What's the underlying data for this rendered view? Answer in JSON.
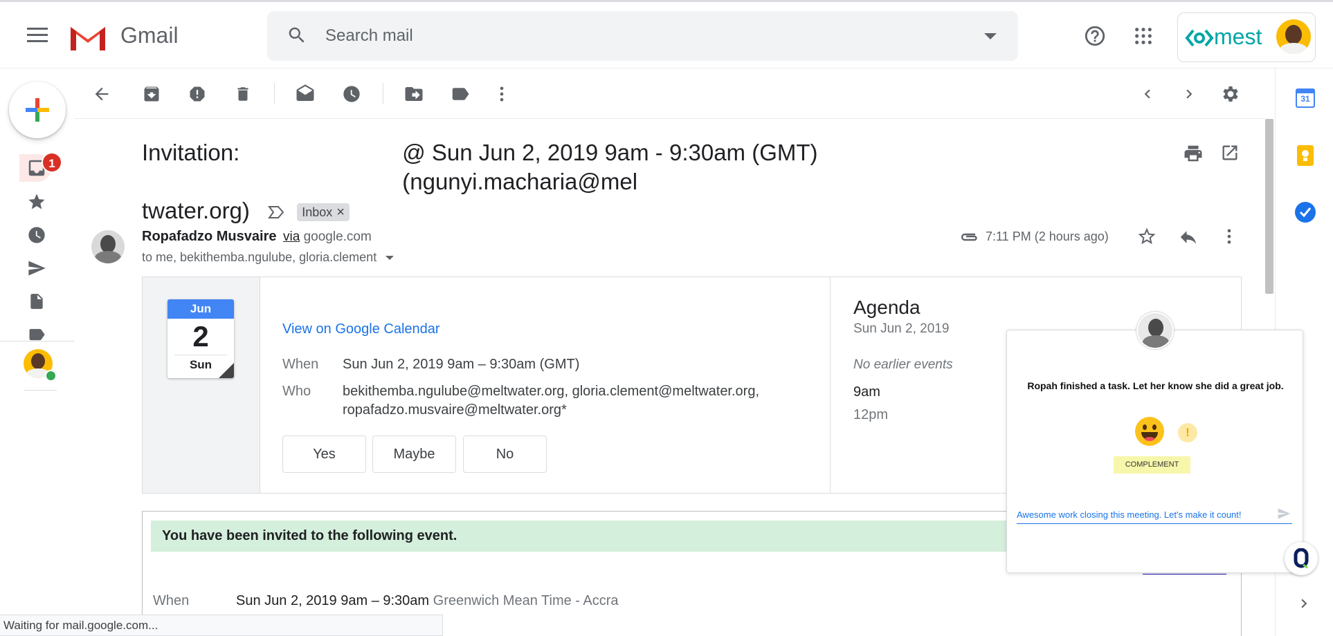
{
  "app": {
    "name": "Gmail"
  },
  "search": {
    "placeholder": "Search mail"
  },
  "account": {
    "org_logo_text": "mest"
  },
  "nav": {
    "inbox_badge": "1"
  },
  "email": {
    "subject_line1_left": "Invitation:",
    "subject_line1_right": "@ Sun Jun 2, 2019 9am - 9:30am (GMT) (ngunyi.macharia@mel",
    "subject_line2": "twater.org)",
    "label": "Inbox",
    "label_remove": "×",
    "sender_name": "Ropafadzo Musvaire",
    "via": "via",
    "via_domain": "google.com",
    "recipients": "to me, bekithemba.ngulube, gloria.clement",
    "time": "7:11 PM (2 hours ago)"
  },
  "invite": {
    "month": "Jun",
    "day": "2",
    "weekday": "Sun",
    "view_link": "View on Google Calendar",
    "when_label": "When",
    "when_value": "Sun Jun 2, 2019 9am – 9:30am (GMT)",
    "who_label": "Who",
    "who_line1": "bekithemba.ngulube@meltwater.org, gloria.clement@meltwater.org,",
    "who_line2": "ropafadzo.musvaire@meltwater.org*",
    "yes": "Yes",
    "maybe": "Maybe",
    "no": "No"
  },
  "agenda": {
    "title": "Agenda",
    "date": "Sun Jun 2, 2019",
    "no_earlier": "No earlier events",
    "slot_1": "9am",
    "slot_2": "12pm"
  },
  "body": {
    "banner": "You have been invited to the following event.",
    "more_details": "more details »",
    "when_label": "When",
    "when_value": "Sun Jun 2, 2019 9am – 9:30am",
    "when_tz": "Greenwich Mean Time - Accra"
  },
  "status_bar": "Waiting for mail.google.com...",
  "popup": {
    "message": "Ropah finished a task. Let her know she did a great job.",
    "alert_glyph": "!",
    "complement_button": "COMPLEMENT",
    "input_value": "Awesome work closing this meeting. Let's make it count!"
  },
  "side_panel": {
    "calendar_day": "31"
  },
  "colors": {
    "accent_blue": "#1a73e8",
    "banner_green": "#d4efdb",
    "badge_red": "#d93025",
    "calendar_blue": "#4285f4",
    "keep_yellow": "#fbbc04",
    "mest_teal": "#00a6a6"
  }
}
